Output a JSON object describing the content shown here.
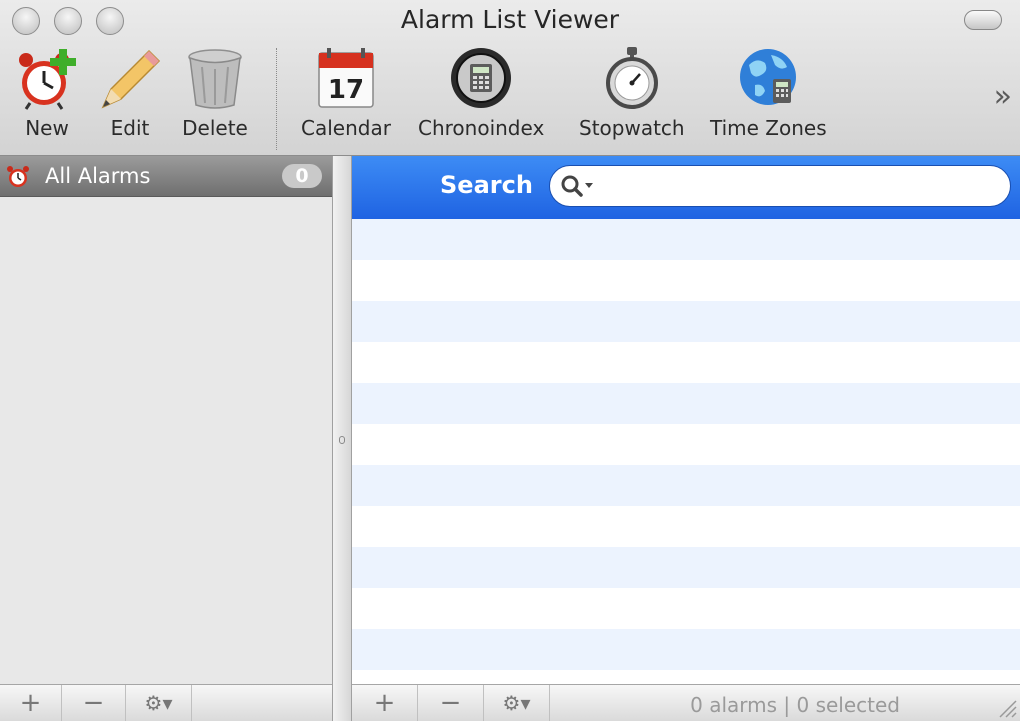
{
  "window": {
    "title": "Alarm List Viewer"
  },
  "toolbar": {
    "new_label": "New",
    "edit_label": "Edit",
    "delete_label": "Delete",
    "calendar_label": "Calendar",
    "calendar_day": "17",
    "chronoindex_label": "Chronoindex",
    "stopwatch_label": "Stopwatch",
    "timezones_label": "Time Zones",
    "overflow_glyph": "»"
  },
  "sidebar": {
    "header_label": "All Alarms",
    "header_count": "0"
  },
  "bottom_bar": {
    "add_glyph": "+",
    "remove_glyph": "−",
    "gear_glyph": "⚙▾"
  },
  "search": {
    "label": "Search",
    "value": "",
    "placeholder": ""
  },
  "status": {
    "text": "0 alarms | 0 selected"
  },
  "colors": {
    "search_bar": "#2a72ec",
    "row_alt": "#ecf3fe",
    "sidebar_bg": "#e8e8e8",
    "header_bg": "#8a8a8a"
  },
  "icons": [
    "alarm-clock-plus-icon",
    "pencil-icon",
    "trash-can-icon",
    "calendar-icon",
    "chronoindex-icon",
    "stopwatch-icon",
    "globe-icon",
    "alarm-clock-icon",
    "search-icon",
    "gear-icon",
    "resize-grip-icon"
  ]
}
